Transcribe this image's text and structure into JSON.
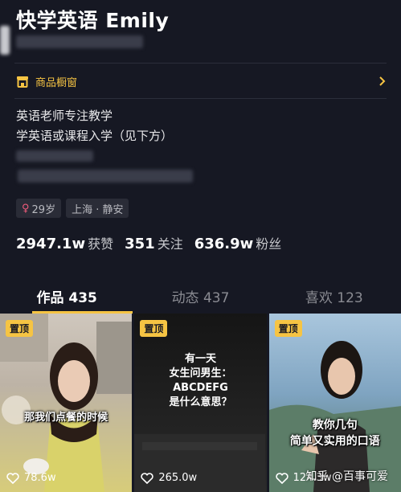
{
  "profile": {
    "name": "快学英语 Emily"
  },
  "shop": {
    "label": "商品橱窗"
  },
  "bio": {
    "line1": "英语老师专注教学",
    "line2": "学英语或课程入学（见下方）"
  },
  "tags": {
    "age": "29岁",
    "location": "上海 · 静安"
  },
  "stats": [
    {
      "value": "2947.1w",
      "label": "获赞"
    },
    {
      "value": "351",
      "label": "关注"
    },
    {
      "value": "636.9w",
      "label": "粉丝"
    }
  ],
  "tabs": [
    {
      "label": "作品 435"
    },
    {
      "label": "动态 437"
    },
    {
      "label": "喜欢 123"
    }
  ],
  "videos": [
    {
      "pin": "置顶",
      "caption": "那我们点餐的时候",
      "likes": "78.6w"
    },
    {
      "pin": "置顶",
      "caption_lines": [
        "有一天",
        "女生问男生：",
        "ABCDEFG",
        "是什么意思？"
      ],
      "likes": "265.0w"
    },
    {
      "pin": "置顶",
      "caption_lines": [
        "教你几句",
        "简单又实用的口语"
      ],
      "likes": "124.3w"
    }
  ],
  "watermark": "知乎 @百事可爱",
  "colors": {
    "background": "#161823",
    "accent": "#f6c443",
    "gender": "#f05b7b"
  }
}
